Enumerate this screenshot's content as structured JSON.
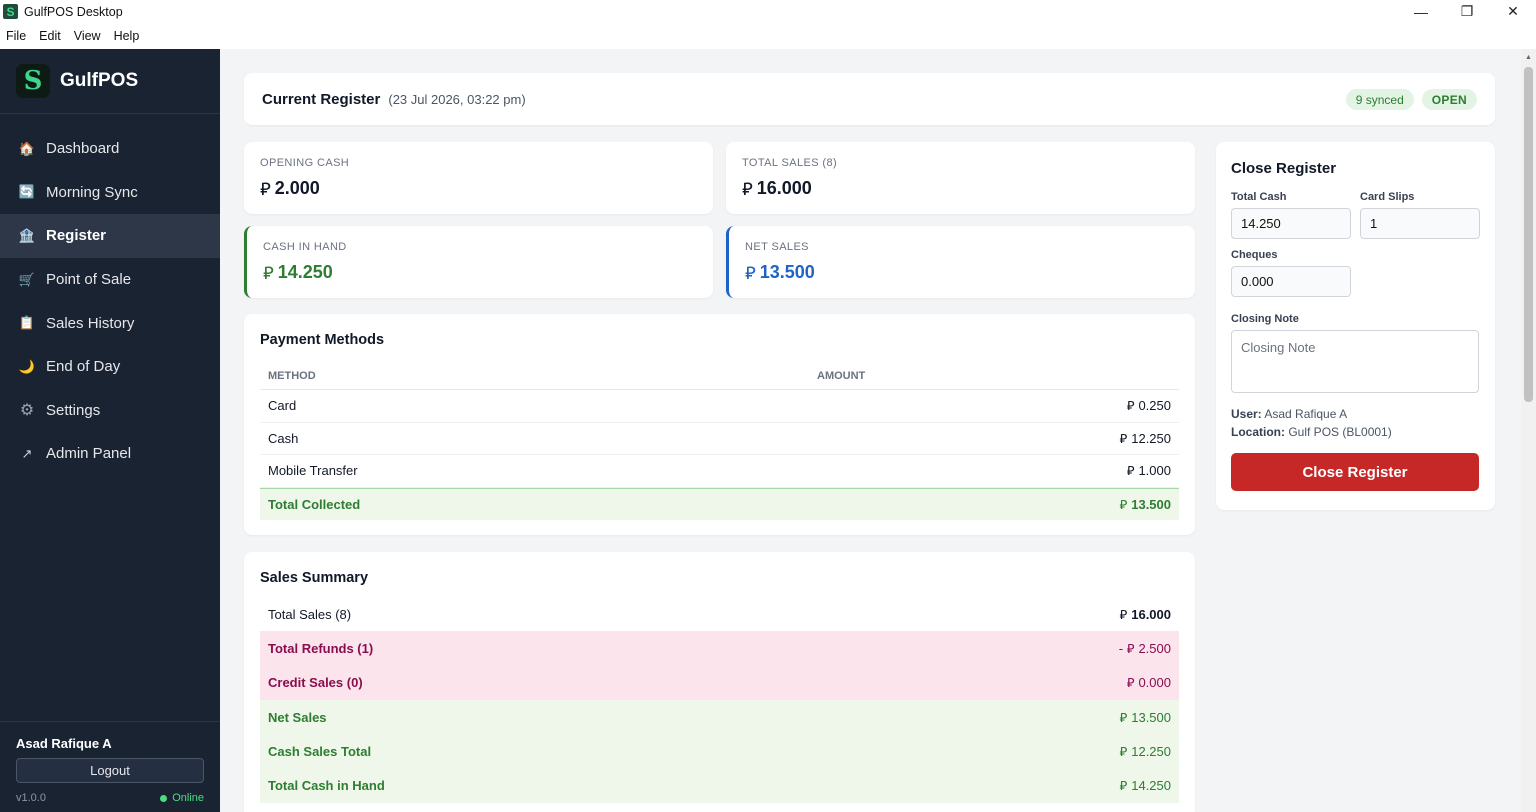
{
  "window": {
    "title": "GulfPOS Desktop",
    "app_icon": "S",
    "minimize": "—",
    "restore": "❐",
    "close": "✕"
  },
  "menu": [
    "File",
    "Edit",
    "View",
    "Help"
  ],
  "sidebar": {
    "brand": "GulfPOS",
    "logo": "S",
    "items": [
      {
        "label": "Dashboard",
        "icon": "🏠",
        "icon_name": "house-icon"
      },
      {
        "label": "Morning Sync",
        "icon": "🔄",
        "icon_name": "sync-icon"
      },
      {
        "label": "Register",
        "icon": "🏦",
        "icon_name": "bank-icon",
        "active": true
      },
      {
        "label": "Point of Sale",
        "icon": "🛒",
        "icon_name": "cart-icon"
      },
      {
        "label": "Sales History",
        "icon": "📋",
        "icon_name": "clipboard-icon"
      },
      {
        "label": "End of Day",
        "icon": "🌙",
        "icon_name": "moon-icon"
      },
      {
        "label": "Settings",
        "icon": "⚙",
        "icon_name": "gear-icon"
      },
      {
        "label": "Admin Panel",
        "icon": "↗",
        "icon_name": "external-link-icon"
      }
    ],
    "user": "Asad Rafique A",
    "logout": "Logout",
    "version": "v1.0.0",
    "status": "Online"
  },
  "currency_symbol": "⃁",
  "header": {
    "title": "Current Register",
    "date": "(23 Jul 2026, 03:22 pm)",
    "synced": "9 synced",
    "status": "OPEN"
  },
  "stats": {
    "opening_cash": {
      "label": "OPENING CASH",
      "value": "2.000"
    },
    "total_sales": {
      "label": "TOTAL SALES (8)",
      "value": "16.000"
    },
    "cash_in_hand": {
      "label": "CASH IN HAND",
      "value": "14.250"
    },
    "net_sales": {
      "label": "NET SALES",
      "value": "13.500"
    }
  },
  "payment_methods": {
    "title": "Payment Methods",
    "col_method": "METHOD",
    "col_amount": "AMOUNT",
    "rows": [
      {
        "method": "Card",
        "amount": "0.250"
      },
      {
        "method": "Cash",
        "amount": "12.250"
      },
      {
        "method": "Mobile Transfer",
        "amount": "1.000"
      }
    ],
    "total_label": "Total Collected",
    "total_amount": "13.500"
  },
  "sales_summary": {
    "title": "Sales Summary",
    "rows": [
      {
        "label": "Total Sales (8)",
        "prefix": "",
        "amount": "16.000",
        "style": "plain"
      },
      {
        "label": "Total Refunds (1)",
        "prefix": "- ",
        "amount": "2.500",
        "style": "pink"
      },
      {
        "label": "Credit Sales (0)",
        "prefix": "",
        "amount": "0.000",
        "style": "pink"
      },
      {
        "label": "Net Sales",
        "prefix": "",
        "amount": "13.500",
        "style": "green"
      },
      {
        "label": "Cash Sales Total",
        "prefix": "",
        "amount": "12.250",
        "style": "green"
      },
      {
        "label": "Total Cash in Hand",
        "prefix": "",
        "amount": "14.250",
        "style": "green"
      }
    ]
  },
  "close_register": {
    "title": "Close Register",
    "total_cash_label": "Total Cash",
    "total_cash_value": "14.250",
    "card_slips_label": "Card Slips",
    "card_slips_value": "1",
    "cheques_label": "Cheques",
    "cheques_value": "0.000",
    "note_label": "Closing Note",
    "note_placeholder": "Closing Note",
    "user_label": "User:",
    "user_value": "Asad Rafique A",
    "location_label": "Location:",
    "location_value": "Gulf POS (BL0001)",
    "button": "Close Register"
  },
  "colors": {
    "sidebar_bg": "#1a2332",
    "accent_green": "#2e7d32",
    "accent_blue": "#1e63c5",
    "danger": "#c62828",
    "brand_green": "#3fd58a"
  }
}
